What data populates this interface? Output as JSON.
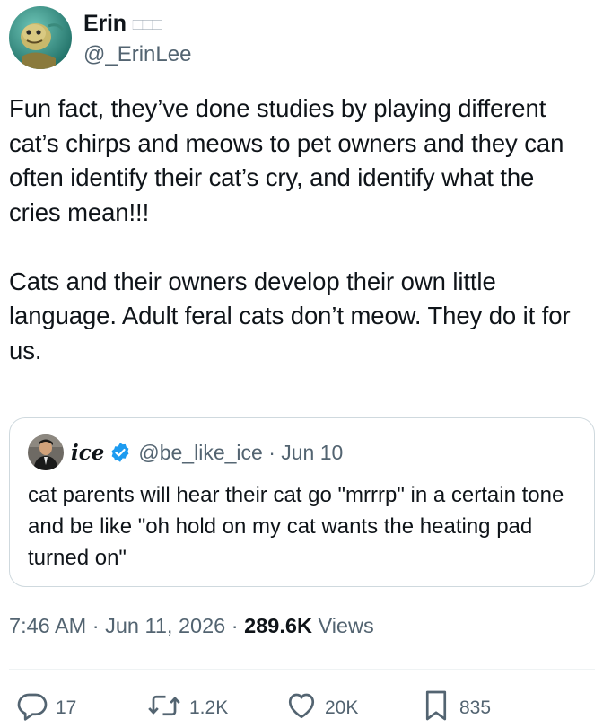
{
  "tweet": {
    "author": {
      "display_name": "Erin",
      "name_emoji": "🏻🏻🏻",
      "handle": "@_ErinLee"
    },
    "text": "Fun fact, they’ve done studies by playing different cat’s chirps and meows to pet owners and they can often identify their cat’s cry, and identify what the cries mean!!!\n\nCats and their owners develop their own little language. Adult feral cats don’t meow. They do it for us.",
    "quoted_tweet": {
      "display_name": "ice",
      "verified": true,
      "meta": "@be_like_ice · Jun 10",
      "text": "cat parents will hear their cat go \"mrrrp\" in a certain tone and be like \"oh hold on my cat wants the heating pad turned on\""
    },
    "timestamp": "7:46 AM · Jun 11, 2026 · ",
    "views_count": "289.6K",
    "views_label": " Views",
    "actions": {
      "replies": "17",
      "reposts": "1.2K",
      "likes": "20K",
      "bookmarks": "835"
    }
  },
  "icons": {
    "verified": "verified-badge-icon",
    "reply": "reply-icon",
    "repost": "repost-icon",
    "like": "heart-icon",
    "bookmark": "bookmark-icon"
  },
  "colors": {
    "text_primary": "#0f1419",
    "text_secondary": "#536471",
    "verified_blue": "#1d9bf0",
    "border": "#cfd9de"
  }
}
